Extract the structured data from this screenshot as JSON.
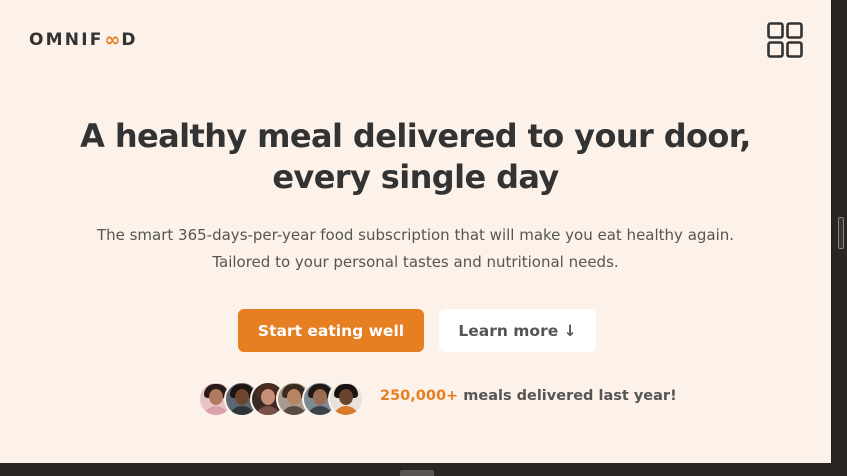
{
  "brand": {
    "name_before": "OMNIF",
    "name_oo": "∞",
    "name_after": "D"
  },
  "header": {
    "menu_icon": "grid-menu-icon"
  },
  "hero": {
    "title_line1": "A healthy meal delivered to your door,",
    "title_line2": "every single day",
    "description_line1": "The smart 365-days-per-year food subscription that will make you eat healthy again.",
    "description_line2": "Tailored to your personal tastes and nutritional needs.",
    "cta_primary": "Start eating well",
    "cta_secondary": "Learn more ↓"
  },
  "delivered": {
    "count": "250,000+",
    "text": " meals delivered last year!"
  },
  "colors": {
    "accent": "#e67e22",
    "background": "#fdf2e9",
    "text_dark": "#333333",
    "text_muted": "#555555"
  }
}
